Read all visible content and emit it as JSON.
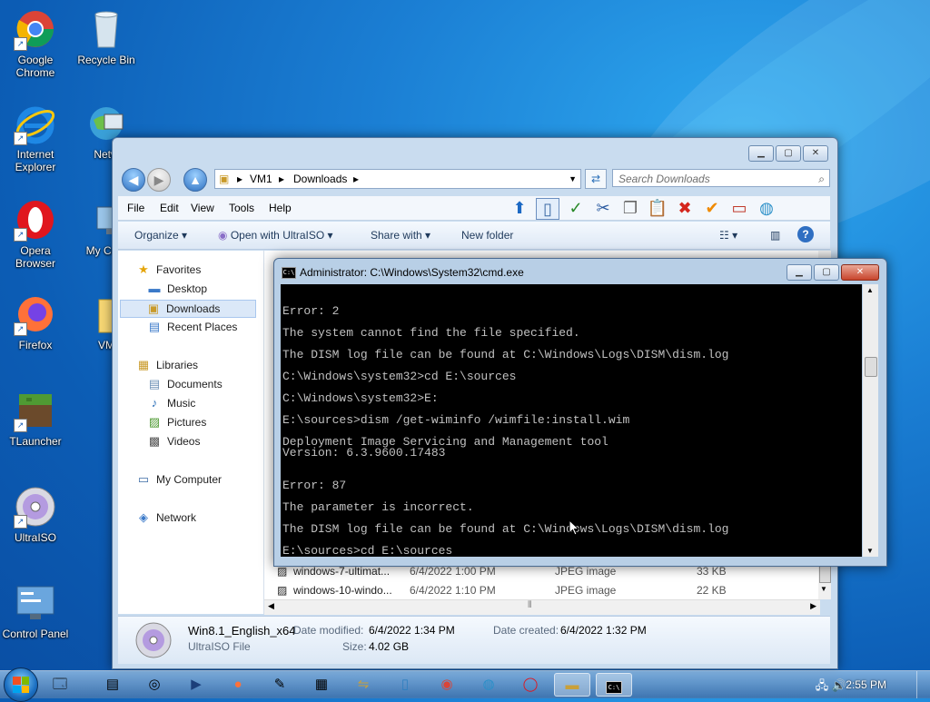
{
  "desktop": {
    "icons": [
      {
        "label": "Google Chrome",
        "icon": "chrome-icon"
      },
      {
        "label": "Recycle Bin",
        "icon": "recycle-bin-icon"
      },
      {
        "label": "Internet Explorer",
        "icon": "ie-icon"
      },
      {
        "label": "Netw",
        "icon": "network-icon"
      },
      {
        "label": "Opera Browser",
        "icon": "opera-icon"
      },
      {
        "label": "My Com",
        "icon": "computer-icon"
      },
      {
        "label": "Firefox",
        "icon": "firefox-icon"
      },
      {
        "label": "VM",
        "icon": "folder-icon"
      },
      {
        "label": "TLauncher",
        "icon": "tlauncher-icon"
      },
      {
        "label": "UltraISO",
        "icon": "ultraiso-icon"
      },
      {
        "label": "Control Panel",
        "icon": "control-panel-icon"
      }
    ]
  },
  "explorer": {
    "breadcrumb": [
      "VM1",
      "Downloads"
    ],
    "search_placeholder": "Search Downloads",
    "menu": [
      "File",
      "Edit",
      "View",
      "Tools",
      "Help"
    ],
    "commands": {
      "organize": "Organize",
      "open_with": "Open with UltraISO",
      "share_with": "Share with",
      "new_folder": "New folder"
    },
    "nav": {
      "favorites": "Favorites",
      "desktop": "Desktop",
      "downloads": "Downloads",
      "recent": "Recent Places",
      "libraries": "Libraries",
      "documents": "Documents",
      "music": "Music",
      "pictures": "Pictures",
      "videos": "Videos",
      "computer": "My Computer",
      "network": "Network"
    },
    "files": [
      {
        "name": "windows-7-ultimat...",
        "date": "6/4/2022 1:00 PM",
        "type": "JPEG image",
        "size": "33 KB"
      },
      {
        "name": "windows-10-windo...",
        "date": "6/4/2022 1:10 PM",
        "type": "JPEG image",
        "size": "22 KB"
      }
    ],
    "details": {
      "name": "Win8.1_English_x64",
      "type": "UltraISO File",
      "modified_label": "Date modified:",
      "modified": "6/4/2022 1:34 PM",
      "created_label": "Date created:",
      "created": "6/4/2022 1:32 PM",
      "size_label": "Size:",
      "size": "4.02 GB"
    }
  },
  "cmd": {
    "title": "Administrator: C:\\Windows\\System32\\cmd.exe",
    "lines": [
      "Error: 2",
      "The system cannot find the file specified.",
      "The DISM log file can be found at C:\\Windows\\Logs\\DISM\\dism.log",
      "C:\\Windows\\system32>cd E:\\sources",
      "C:\\Windows\\system32>E:",
      "E:\\sources>dism /get-wiminfo /wimfile:install.wim",
      "Deployment Image Servicing and Management tool",
      "Version: 6.3.9600.17483",
      "Error: 87",
      "The parameter is incorrect.",
      "The DISM log file can be found at C:\\Windows\\Logs\\DISM\\dism.log",
      "E:\\sources>cd E:\\sources"
    ]
  },
  "taskbar": {
    "time": "2:55 PM",
    "apps": [
      "explorer-icon",
      "paint-icon",
      "steam-icon",
      "powershell-icon",
      "firefox-icon",
      "notepad-icon",
      "archive-icon",
      "network-share-icon",
      "phone-icon",
      "chrome-icon",
      "globe-icon",
      "opera-icon",
      "folder-icon",
      "cmd-icon"
    ]
  }
}
